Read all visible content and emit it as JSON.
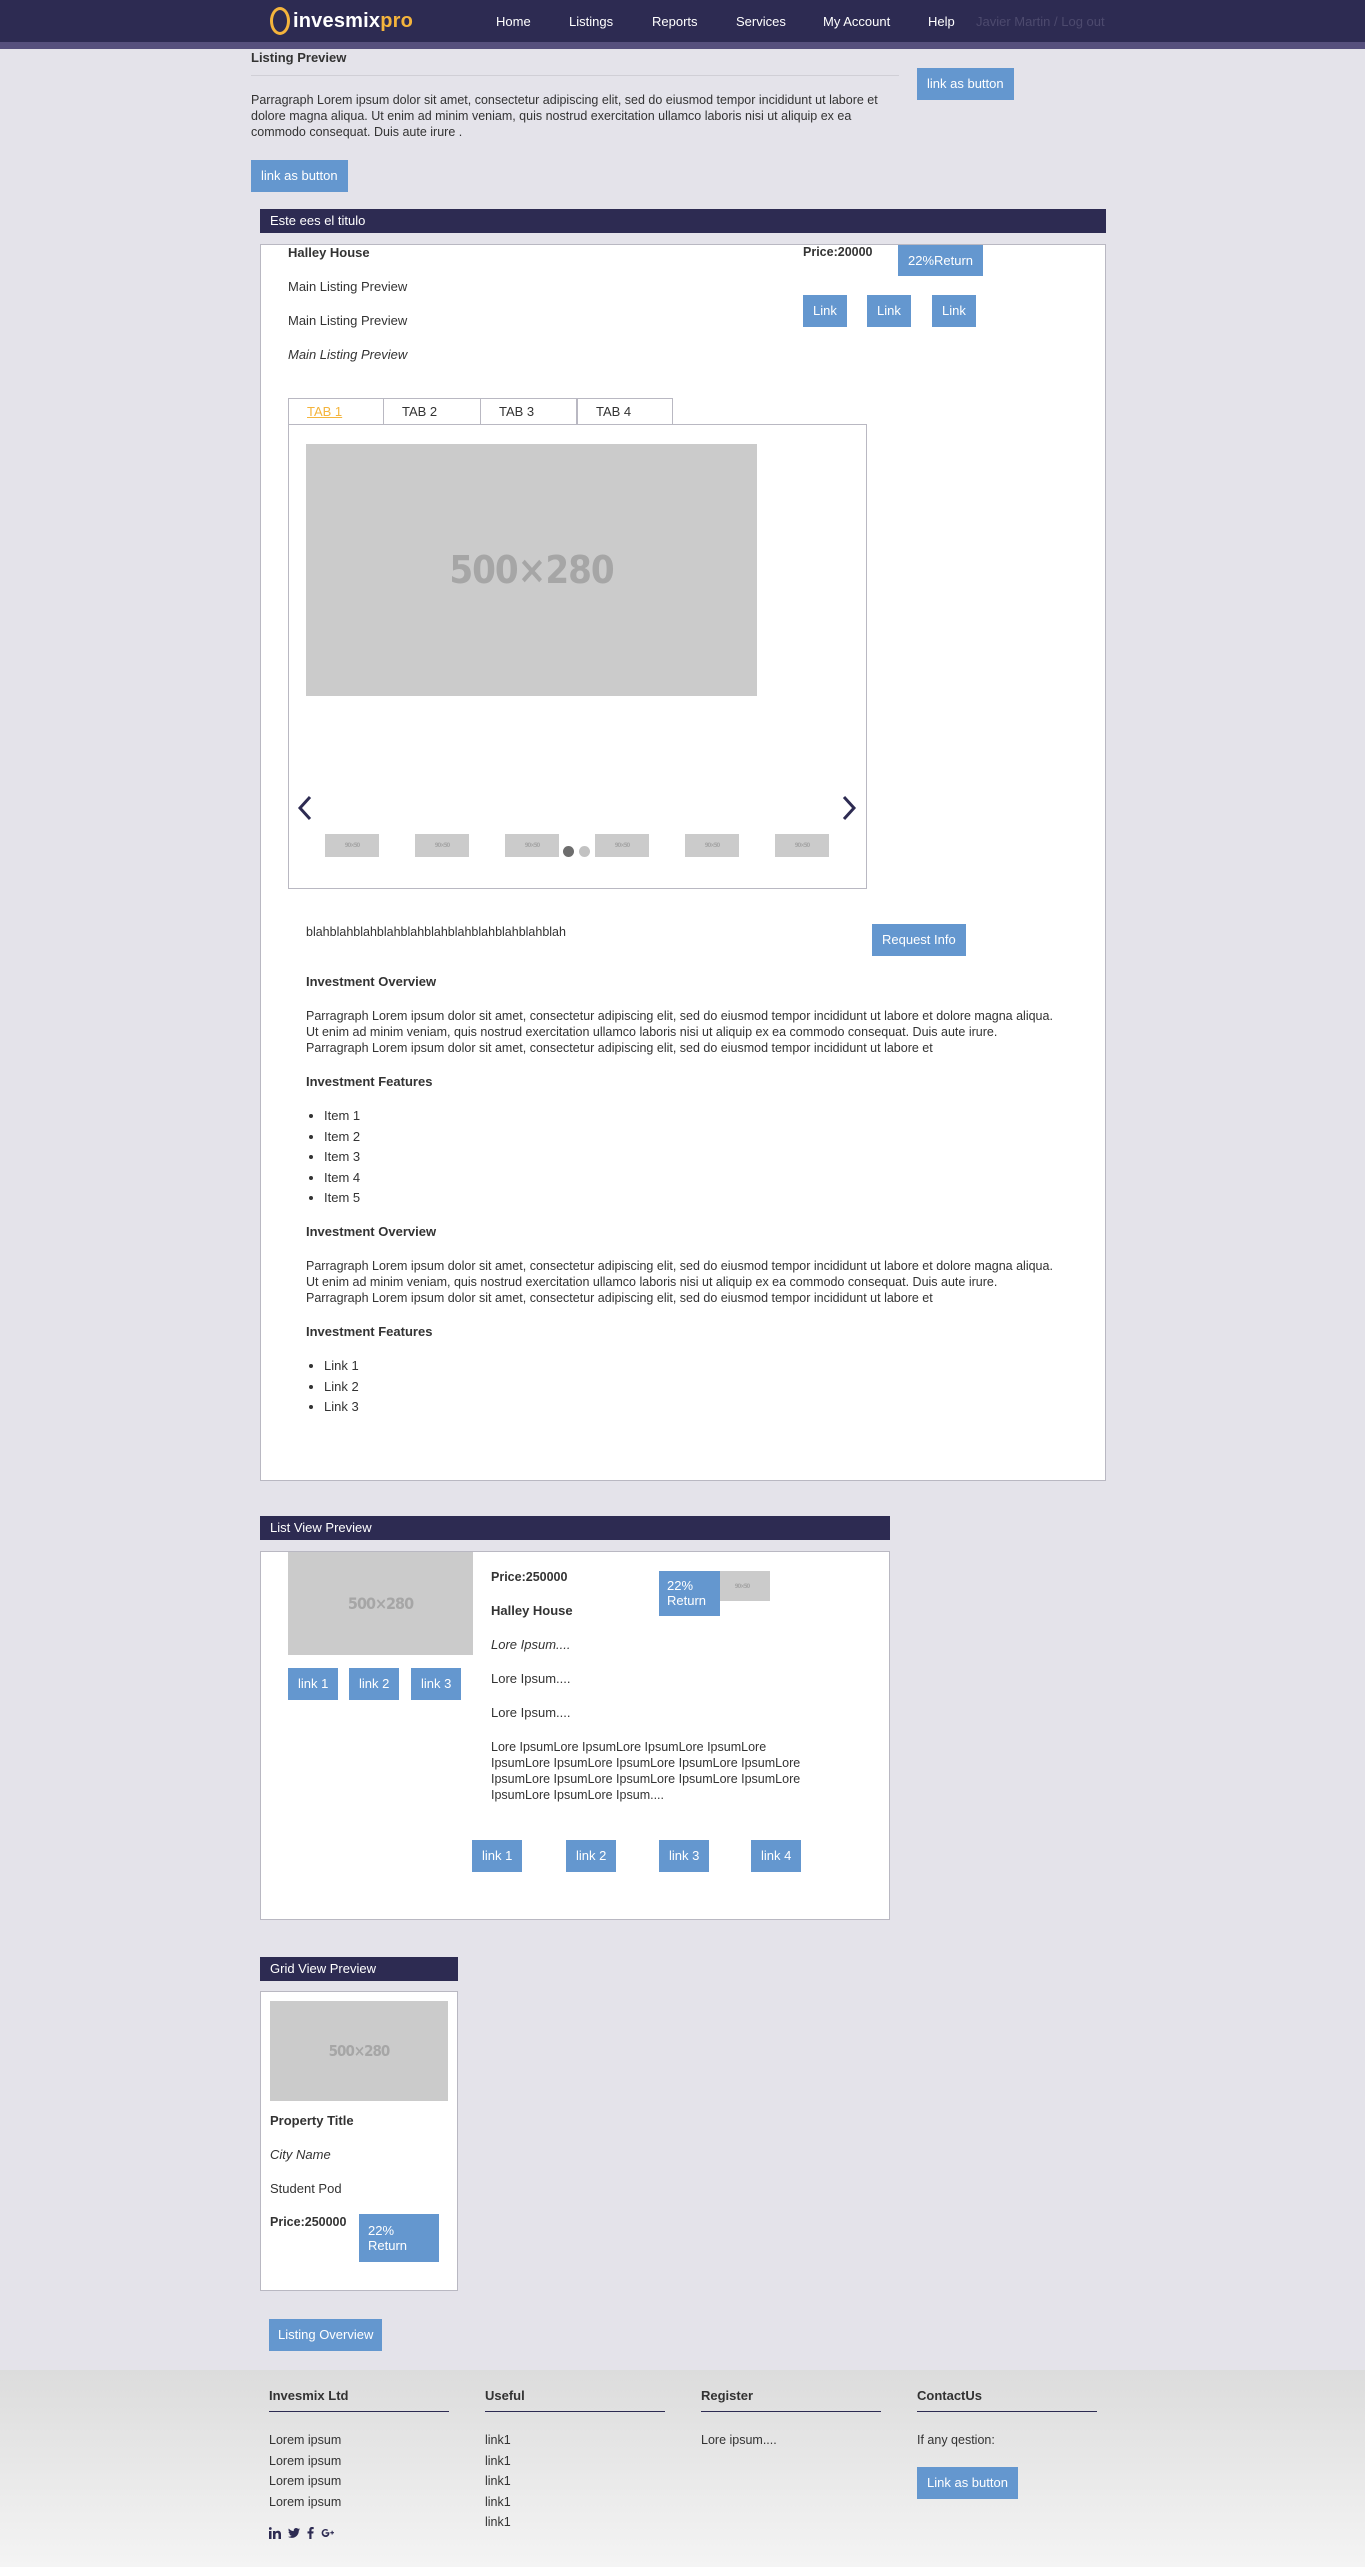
{
  "nav": {
    "logo_main": "invesmix",
    "logo_accent": "pro",
    "items": [
      "Home",
      "Listings",
      "Reports",
      "Services",
      "My Account",
      "Help"
    ],
    "user": "Javier Martin / Log out"
  },
  "listing_preview": {
    "title": "Listing Preview",
    "paragraph": "Parragraph Lorem ipsum dolor sit amet, consectetur adipiscing elit, sed do eiusmod tempor incididunt ut labore et dolore magna aliqua. Ut enim ad minim veniam, quis nostrud exercitation ullamco laboris nisi ut aliquip ex ea commodo consequat. Duis aute irure .",
    "side_button": "link as button",
    "button": "link as button"
  },
  "main_listing": {
    "header": "Este ees el titulo",
    "name": "Halley House",
    "line1": "Main Listing Preview",
    "line2": "Main Listing Preview",
    "line3": "Main Listing Preview",
    "price": "Price:20000",
    "return_badge": "22%Return",
    "links": [
      "Link",
      "Link",
      "Link"
    ],
    "tabs": [
      "TAB 1",
      "TAB 2",
      "TAB 3",
      "TAB 4"
    ],
    "slide_placeholder": "500×280",
    "thumb_placeholder": "90×50",
    "blah": "blahblahblahblahblahblahblahblahblahblahblah",
    "request_button": "Request Info",
    "overview_title": "Investment Overview",
    "overview_text": "Parragraph Lorem ipsum dolor sit amet, consectetur adipiscing elit, sed do eiusmod tempor incididunt ut labore et dolore magna aliqua. Ut enim ad minim veniam, quis nostrud exercitation ullamco laboris nisi ut aliquip ex ea commodo consequat. Duis aute irure. Parragraph Lorem ipsum dolor sit amet, consectetur adipiscing elit, sed do eiusmod tempor incididunt ut labore et",
    "features_title": "Investment Features",
    "features": [
      "Item 1",
      "Item 2",
      "Item 3",
      "Item 4",
      "Item 5"
    ],
    "overview2_title": "Investment Overview",
    "overview2_text": "Parragraph Lorem ipsum dolor sit amet, consectetur adipiscing elit, sed do eiusmod tempor incididunt ut labore et dolore magna aliqua. Ut enim ad minim veniam, quis nostrud exercitation ullamco laboris nisi ut aliquip ex ea commodo consequat. Duis aute irure. Parragraph Lorem ipsum dolor sit amet, consectetur adipiscing elit, sed do eiusmod tempor incididunt ut labore et",
    "features2_title": "Investment Features",
    "feature_links": [
      "Link 1",
      "Link 2",
      "Link 3"
    ]
  },
  "list_view": {
    "header": "List View Preview",
    "placeholder": "500×280",
    "thumb_placeholder": "90×50",
    "image_links": [
      "link 1",
      "link 2",
      "link 3"
    ],
    "price": "Price:250000",
    "return_badge": "22% Return",
    "name": "Halley House",
    "lore_italic": "Lore Ipsum....",
    "lore1": "Lore Ipsum....",
    "lore2": "Lore Ipsum....",
    "lore_long": "Lore IpsumLore IpsumLore IpsumLore IpsumLore IpsumLore IpsumLore IpsumLore IpsumLore IpsumLore IpsumLore IpsumLore IpsumLore IpsumLore IpsumLore IpsumLore IpsumLore Ipsum....",
    "bottom_links": [
      "link 1",
      "link 2",
      "link 3",
      "link 4"
    ]
  },
  "grid_view": {
    "header": "Grid View Preview",
    "placeholder": "500×280",
    "title": "Property Title",
    "city": "City Name",
    "type": "Student Pod",
    "price": "Price:250000",
    "return_badge": "22% Return"
  },
  "overview_button": "Listing Overview",
  "footer": {
    "col1": {
      "title": "Invesmix Ltd",
      "lines": [
        "Lorem ipsum",
        "Lorem ipsum",
        "Lorem ipsum",
        "Lorem ipsum"
      ]
    },
    "col2": {
      "title": "Useful",
      "lines": [
        "link1",
        "link1",
        "link1",
        "link1",
        "link1"
      ]
    },
    "col3": {
      "title": "Register",
      "lines": [
        "Lore ipsum...."
      ]
    },
    "col4": {
      "title": "ContactUs",
      "text": "If any qestion:",
      "button": "Link as button"
    },
    "social_icons": [
      "linkedin-icon",
      "twitter-icon",
      "facebook-icon",
      "google-plus-icon"
    ]
  },
  "colors": {
    "navbar": "#2d2b52",
    "accent": "#f4b43c",
    "button": "#6497cf",
    "background": "#e4e3ea"
  }
}
